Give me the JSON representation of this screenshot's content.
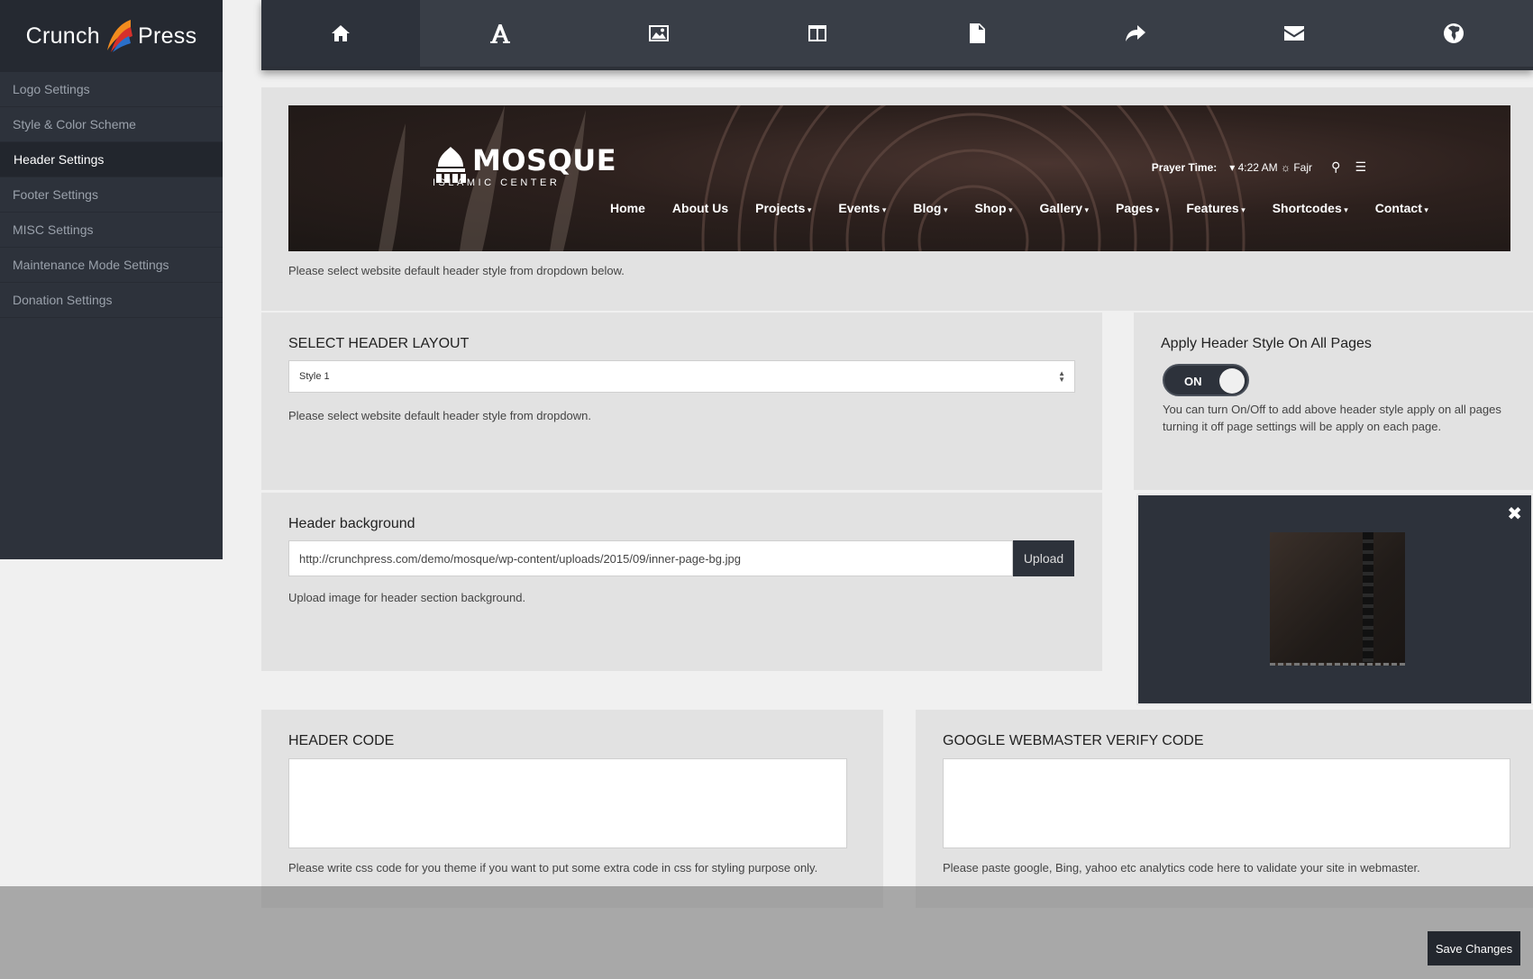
{
  "brand": {
    "name_left": "Crunch",
    "name_right": "Press"
  },
  "sidebar": {
    "items": [
      {
        "label": "Logo Settings"
      },
      {
        "label": "Style & Color Scheme"
      },
      {
        "label": "Header Settings"
      },
      {
        "label": "Footer Settings"
      },
      {
        "label": "MISC Settings"
      },
      {
        "label": "Maintenance Mode Settings"
      },
      {
        "label": "Donation Settings"
      }
    ],
    "active_index": 2
  },
  "topbar": {
    "tabs": [
      {
        "icon": "home-icon"
      },
      {
        "icon": "font-icon"
      },
      {
        "icon": "image-icon"
      },
      {
        "icon": "columns-icon"
      },
      {
        "icon": "document-icon"
      },
      {
        "icon": "share-icon"
      },
      {
        "icon": "envelope-icon"
      },
      {
        "icon": "globe-icon"
      }
    ],
    "active_index": 0
  },
  "preview": {
    "logo_title": "MOSQUE",
    "logo_subtitle": "ISLAMIC CENTER",
    "prayer_label": "Prayer Time:",
    "prayer_time": "4:22 AM",
    "prayer_name": "Fajr",
    "nav": [
      {
        "label": "Home",
        "dropdown": false
      },
      {
        "label": "About Us",
        "dropdown": false
      },
      {
        "label": "Projects",
        "dropdown": true
      },
      {
        "label": "Events",
        "dropdown": true
      },
      {
        "label": "Blog",
        "dropdown": true
      },
      {
        "label": "Shop",
        "dropdown": true
      },
      {
        "label": "Gallery",
        "dropdown": true
      },
      {
        "label": "Pages",
        "dropdown": true
      },
      {
        "label": "Features",
        "dropdown": true
      },
      {
        "label": "Shortcodes",
        "dropdown": true
      },
      {
        "label": "Contact",
        "dropdown": true
      }
    ],
    "note": "Please select website default header style from dropdown below."
  },
  "layout": {
    "title": "SELECT HEADER LAYOUT",
    "selected": "Style 1",
    "note": "Please select website default header style from dropdown."
  },
  "apply": {
    "title": "Apply Header Style On All Pages",
    "toggle_label": "ON",
    "toggle_state": "on",
    "desc": "You can turn On/Off to add above header style apply on all pages turning it off page settings will be apply on each page."
  },
  "background": {
    "title": "Header background",
    "url": "http://crunchpress.com/demo/mosque/wp-content/uploads/2015/09/inner-page-bg.jpg",
    "upload_label": "Upload",
    "note": "Upload image for header section background."
  },
  "header_code": {
    "title": "HEADER CODE",
    "value": "",
    "note": "Please write css code for you theme if you want to put some extra code in css for styling purpose only."
  },
  "verify_code": {
    "title": "GOOGLE WEBMASTER VERIFY CODE",
    "value": "",
    "note": "Please paste google, Bing, yahoo etc analytics code here to validate your site in webmaster."
  },
  "save_label": "Save Changes",
  "colors": {
    "sidebar_bg": "#2d323b",
    "topbar_bg": "#393e47",
    "panel_bg": "#e2e2e2",
    "button_dark": "#23272e"
  }
}
